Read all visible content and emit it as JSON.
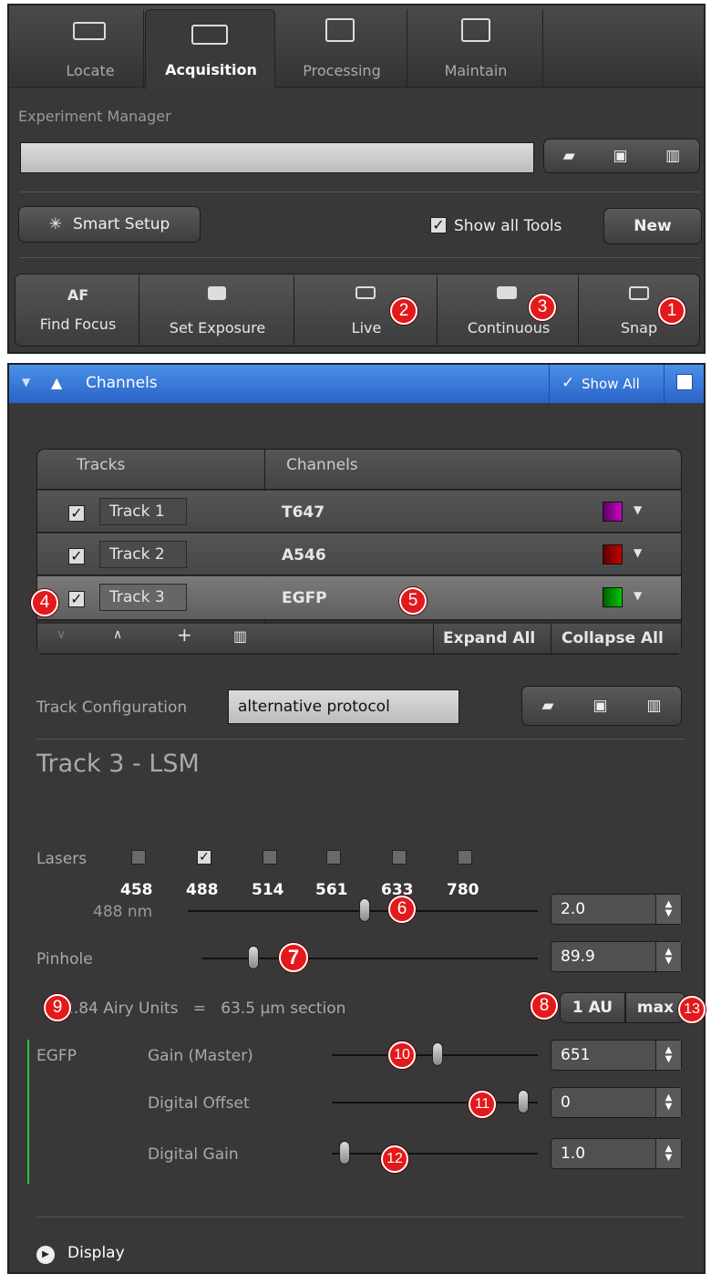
{
  "tabs": [
    {
      "label": "Locate",
      "icon": "locate-icon"
    },
    {
      "label": "Acquisition",
      "icon": "acquisition-icon"
    },
    {
      "label": "Processing",
      "icon": "processing-icon"
    },
    {
      "label": "Maintain",
      "icon": "maintain-icon"
    }
  ],
  "experiment": {
    "title": "Experiment Manager",
    "value": ""
  },
  "toolbar": {
    "smart_setup": "Smart Setup",
    "show_all_tools": "Show all Tools",
    "new": "New"
  },
  "actions": [
    {
      "line1": "AF",
      "line2": "Find Focus"
    },
    {
      "line1": "",
      "line2": "Set Exposure"
    },
    {
      "line1": "",
      "line2": "Live"
    },
    {
      "line1": "",
      "line2": "Continuous"
    },
    {
      "line1": "",
      "line2": "Snap"
    }
  ],
  "channels": {
    "title": "Channels",
    "show_all": "Show All"
  },
  "table": {
    "headers": [
      "Tracks",
      "Channels"
    ],
    "rows": [
      {
        "track": "Track 1",
        "channel": "T647",
        "color": "#c800c8"
      },
      {
        "track": "Track 2",
        "channel": "A546",
        "color": "#c80000"
      },
      {
        "track": "Track 3",
        "channel": "EGFP",
        "color": "#00c800"
      }
    ],
    "expand_all": "Expand All",
    "collapse_all": "Collapse All"
  },
  "track_config": {
    "label": "Track Configuration",
    "value": "alternative protocol"
  },
  "track_title": "Track 3 - LSM",
  "lasers": {
    "label": "Lasers",
    "items": [
      {
        "wl": "458",
        "checked": false
      },
      {
        "wl": "488",
        "checked": true
      },
      {
        "wl": "514",
        "checked": false
      },
      {
        "wl": "561",
        "checked": false
      },
      {
        "wl": "633",
        "checked": false
      },
      {
        "wl": "780",
        "checked": false
      }
    ]
  },
  "laser488": {
    "label": "488 nm",
    "value": "2.0"
  },
  "pinhole": {
    "label": "Pinhole",
    "value": "89.9",
    "airy": "2.84 Airy Units   =   63.5 µm section",
    "btn_1au": "1 AU",
    "btn_max": "max"
  },
  "egfp": {
    "name": "EGFP",
    "gain_label": "Gain (Master)",
    "gain": "651",
    "offset_label": "Digital Offset",
    "offset": "0",
    "dgain_label": "Digital Gain",
    "dgain": "1.0"
  },
  "display": "Display",
  "badges": [
    "1",
    "2",
    "3",
    "4",
    "5",
    "6",
    "7",
    "8",
    "9",
    "10",
    "11",
    "12",
    "13"
  ]
}
